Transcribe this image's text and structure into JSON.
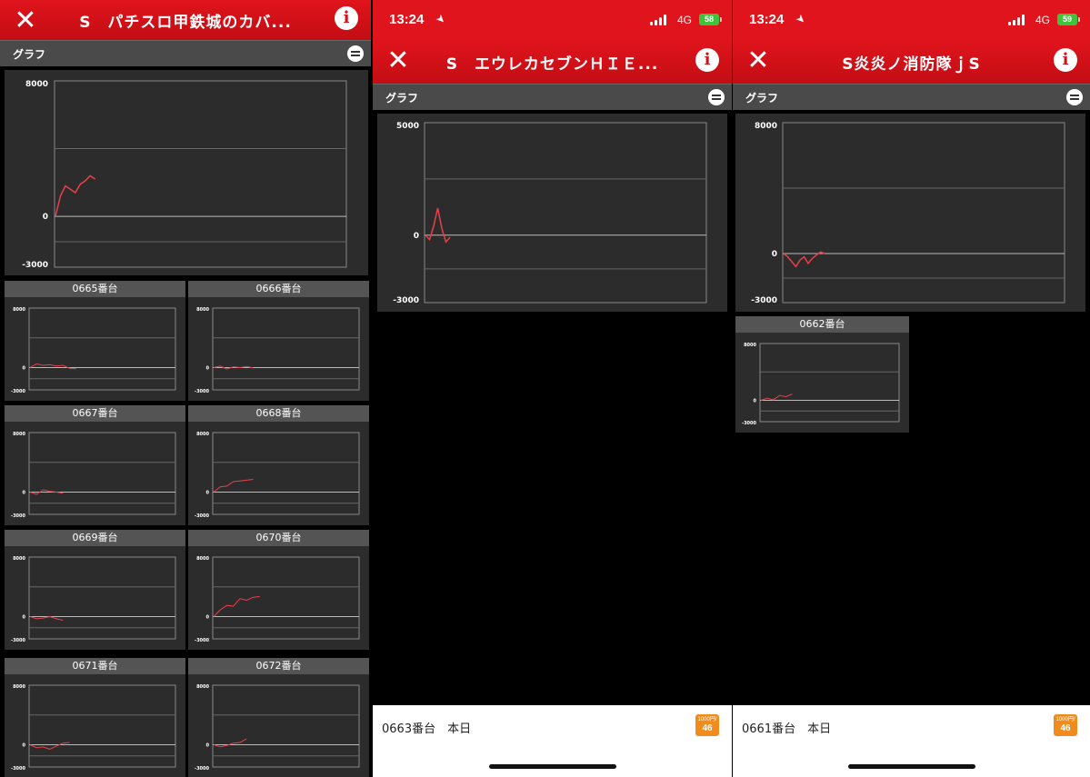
{
  "theme": {
    "accent": "#e0141c",
    "panel_bg": "#2c2c2c",
    "line": "#e8404a",
    "battery_green": "#3ec33a",
    "badge_orange": "#f08c1e"
  },
  "icons": {
    "close": "close-icon",
    "info": "info-icon",
    "collapse": "collapse-icon",
    "location": "location-arrow-icon"
  },
  "screens": [
    {
      "title": "S　パチスロ甲鉄城のカバ...",
      "section_label": "グラフ",
      "main_graph": {
        "ymax": "8000",
        "zero": "0",
        "ymin": "-3000",
        "lo": -3000,
        "hi": 8000,
        "points": [
          0,
          1200,
          1800,
          1600,
          1400,
          1900,
          2100,
          2400,
          2200
        ]
      },
      "machines": [
        {
          "label": "0665番台",
          "ymax": "8000",
          "zero": "0",
          "ymin": "-3000",
          "points": [
            0,
            500,
            300,
            400,
            200,
            300,
            -100,
            -150
          ]
        },
        {
          "label": "0666番台",
          "ymax": "8000",
          "zero": "0",
          "ymin": "-3000",
          "points": [
            0,
            200,
            -200,
            100,
            0,
            150,
            -50
          ]
        },
        {
          "label": "0667番台",
          "ymax": "8000",
          "zero": "0",
          "ymin": "-3000",
          "points": [
            0,
            -300,
            300,
            100,
            0,
            -150
          ]
        },
        {
          "label": "0668番台",
          "ymax": "8000",
          "zero": "0",
          "ymin": "-3000",
          "points": [
            0,
            700,
            800,
            1400,
            1500,
            1600,
            1700
          ]
        },
        {
          "label": "0669番台",
          "ymax": "8000",
          "zero": "0",
          "ymin": "-3000",
          "points": [
            0,
            -300,
            -200,
            0,
            -300,
            -500
          ]
        },
        {
          "label": "0670番台",
          "ymax": "8000",
          "zero": "0",
          "ymin": "-3000",
          "points": [
            0,
            900,
            1500,
            1400,
            2400,
            2200,
            2600,
            2700
          ]
        },
        {
          "label": "0671番台",
          "ymax": "8000",
          "zero": "0",
          "ymin": "-3000",
          "points": [
            0,
            -400,
            -300,
            -600,
            -200,
            200,
            300
          ]
        },
        {
          "label": "0672番台",
          "ymax": "8000",
          "zero": "0",
          "ymin": "-3000",
          "points": [
            0,
            -300,
            -100,
            200,
            300,
            800
          ]
        }
      ]
    },
    {
      "status": {
        "time": "13:24",
        "network": "4G",
        "battery": "58"
      },
      "title": "S　エウレカセブンＨＩＥ...",
      "section_label": "グラフ",
      "main_graph": {
        "ymax": "5000",
        "zero": "0",
        "ymin": "-3000",
        "lo": -3000,
        "hi": 5000,
        "points": [
          0,
          -200,
          400,
          1200,
          300,
          -300,
          -100
        ]
      },
      "footer": {
        "text": "0663番台　本日",
        "badge_top": "1000円/",
        "badge_num": "46"
      }
    },
    {
      "status": {
        "time": "13:24",
        "network": "4G",
        "battery": "59"
      },
      "title": "S炎炎ノ消防隊ｊS",
      "section_label": "グラフ",
      "main_graph": {
        "ymax": "8000",
        "zero": "0",
        "ymin": "-3000",
        "lo": -3000,
        "hi": 8000,
        "points": [
          0,
          -200,
          -500,
          -800,
          -400,
          -200,
          -600,
          -300,
          -100,
          100,
          0
        ]
      },
      "machines": [
        {
          "label": "0662番台",
          "ymax": "8000",
          "zero": "0",
          "ymin": "-3000",
          "points": [
            0,
            300,
            100,
            700,
            500,
            900
          ]
        }
      ],
      "footer": {
        "text": "0661番台　本日",
        "badge_top": "1000円/",
        "badge_num": "46"
      }
    }
  ]
}
